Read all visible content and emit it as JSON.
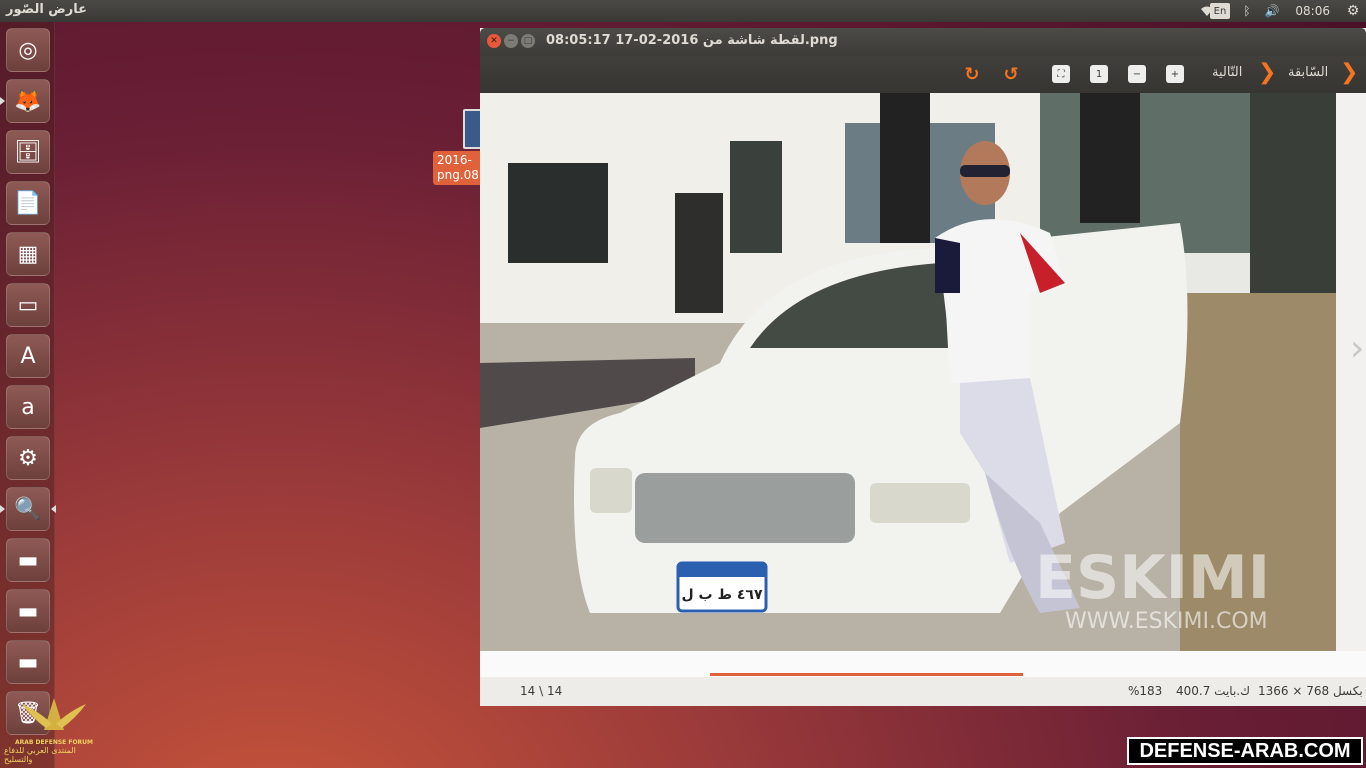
{
  "top_panel": {
    "app_title": "عارض الصّور",
    "clock": "08:06",
    "lang": "En"
  },
  "launcher": {
    "items": [
      {
        "name": "ubuntu-dash",
        "glyph": "◎"
      },
      {
        "name": "firefox",
        "glyph": "🦊"
      },
      {
        "name": "files",
        "glyph": "🗄"
      },
      {
        "name": "writer",
        "glyph": "📄"
      },
      {
        "name": "calc",
        "glyph": "▦"
      },
      {
        "name": "impress",
        "glyph": "▭"
      },
      {
        "name": "software-center",
        "glyph": "A"
      },
      {
        "name": "amazon",
        "glyph": "a"
      },
      {
        "name": "system-settings",
        "glyph": "⚙"
      },
      {
        "name": "image-viewer",
        "glyph": "🔍"
      },
      {
        "name": "drive-1",
        "glyph": "▬"
      },
      {
        "name": "drive-2",
        "glyph": "▬"
      },
      {
        "name": "drive-3",
        "glyph": "▬"
      },
      {
        "name": "trash",
        "glyph": "🗑"
      }
    ]
  },
  "desktop": {
    "icon_label_line1": "2016-",
    "icon_label_line2": "png.08"
  },
  "viewer": {
    "title": "لقطة شاشة من 2016-02-17 08:05:17.png",
    "toolbar": {
      "prev_label": "السّابقة",
      "next_label": "التّالية"
    },
    "status": {
      "dimensions": "1366 × 768 بكسل",
      "file_size": "400.7 ك.بايت",
      "zoom": "%183",
      "page_count": "14 \\ 14"
    },
    "scrub_progress": 0.35
  },
  "photo": {
    "plate": "٤٦٧ ط ب ل",
    "watermark": "ESKIMI",
    "watermark_url": "WWW.ESKIMI.COM"
  },
  "watermarks": {
    "forum_en": "ARAB DEFENSE FORUM",
    "forum_ar": "المنتدى العربي للدفاع والتسليح",
    "site": "DEFENSE-ARAB.COM"
  },
  "colors": {
    "accent": "#f47421",
    "panel": "#3c3b37",
    "close": "#e8583a"
  }
}
